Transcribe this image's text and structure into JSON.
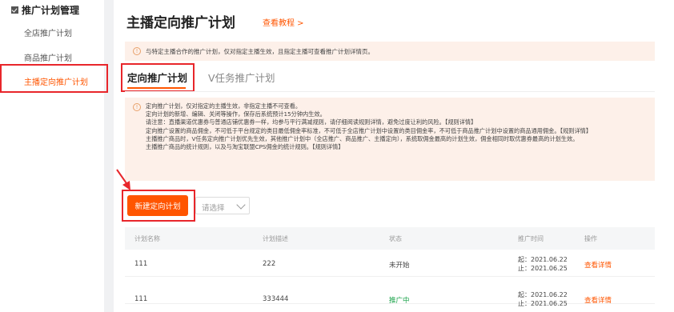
{
  "sidebar": {
    "heading": "推广计划管理",
    "items": [
      {
        "label": "全店推广计划"
      },
      {
        "label": "商品推广计划"
      },
      {
        "label": "主播定向推广计划"
      }
    ]
  },
  "header": {
    "title": "主播定向推广计划",
    "tutorial_link": "查看教程 >"
  },
  "notice_top": "与特定主播合作的推广计划，仅对指定主播生效，且指定主播可查看推广计划详情页。",
  "tabs": [
    {
      "label": "定向推广计划"
    },
    {
      "label": "V任务推广计划"
    }
  ],
  "notice_rules": [
    "定向推广计划，仅对指定的主播生效，非指定主播不可查看。",
    "定向计划的新增、编辑、关闭等操作，保存后系统预计15分钟内生效。",
    "请注意：直播渠道优惠券与普通店铺优惠券一样，均参与平行满减规则，请仔细阅读规则详情，避免过度让利的风险。【规则详情】",
    "定向推广设置的商品佣金，不可低于平台规定的类目最低佣金率标准，不可低于全店推广计划中设置的类目佣金率，不可低于商品推广计划中设置的商品通用佣金。【规则详情】",
    "主播推广商品时，V任务定向推广计划优先生效，其他推广计划中（全店推广、商品推广、主播定向），系统取佣金最高的计划生效，佣金相同时取优惠券最高的计划生效。",
    "主播推广商品的统计规则，以及与淘宝联盟CPS佣金的统计规则。【规则详情】"
  ],
  "actions": {
    "create_button": "新建定向计划",
    "select_placeholder": "请选择"
  },
  "table": {
    "columns": [
      "计划名称",
      "计划描述",
      "状态",
      "推广时间",
      "操作"
    ],
    "rows": [
      {
        "name": "111",
        "desc": "222",
        "status": "未开始",
        "start": "起：2021.06.22",
        "end": "止：2021.06.25",
        "action": "查看详情"
      },
      {
        "name": "111",
        "desc": "333444",
        "status": "推广中",
        "start": "起：2021.06.22",
        "end": "止：2021.06.25",
        "action": "查看详情"
      }
    ]
  },
  "colors": {
    "accent": "#ff5500",
    "highlight_box": "#e8262b",
    "notice_bg": "#fdf0e9",
    "status_running": "#1aa34a"
  }
}
